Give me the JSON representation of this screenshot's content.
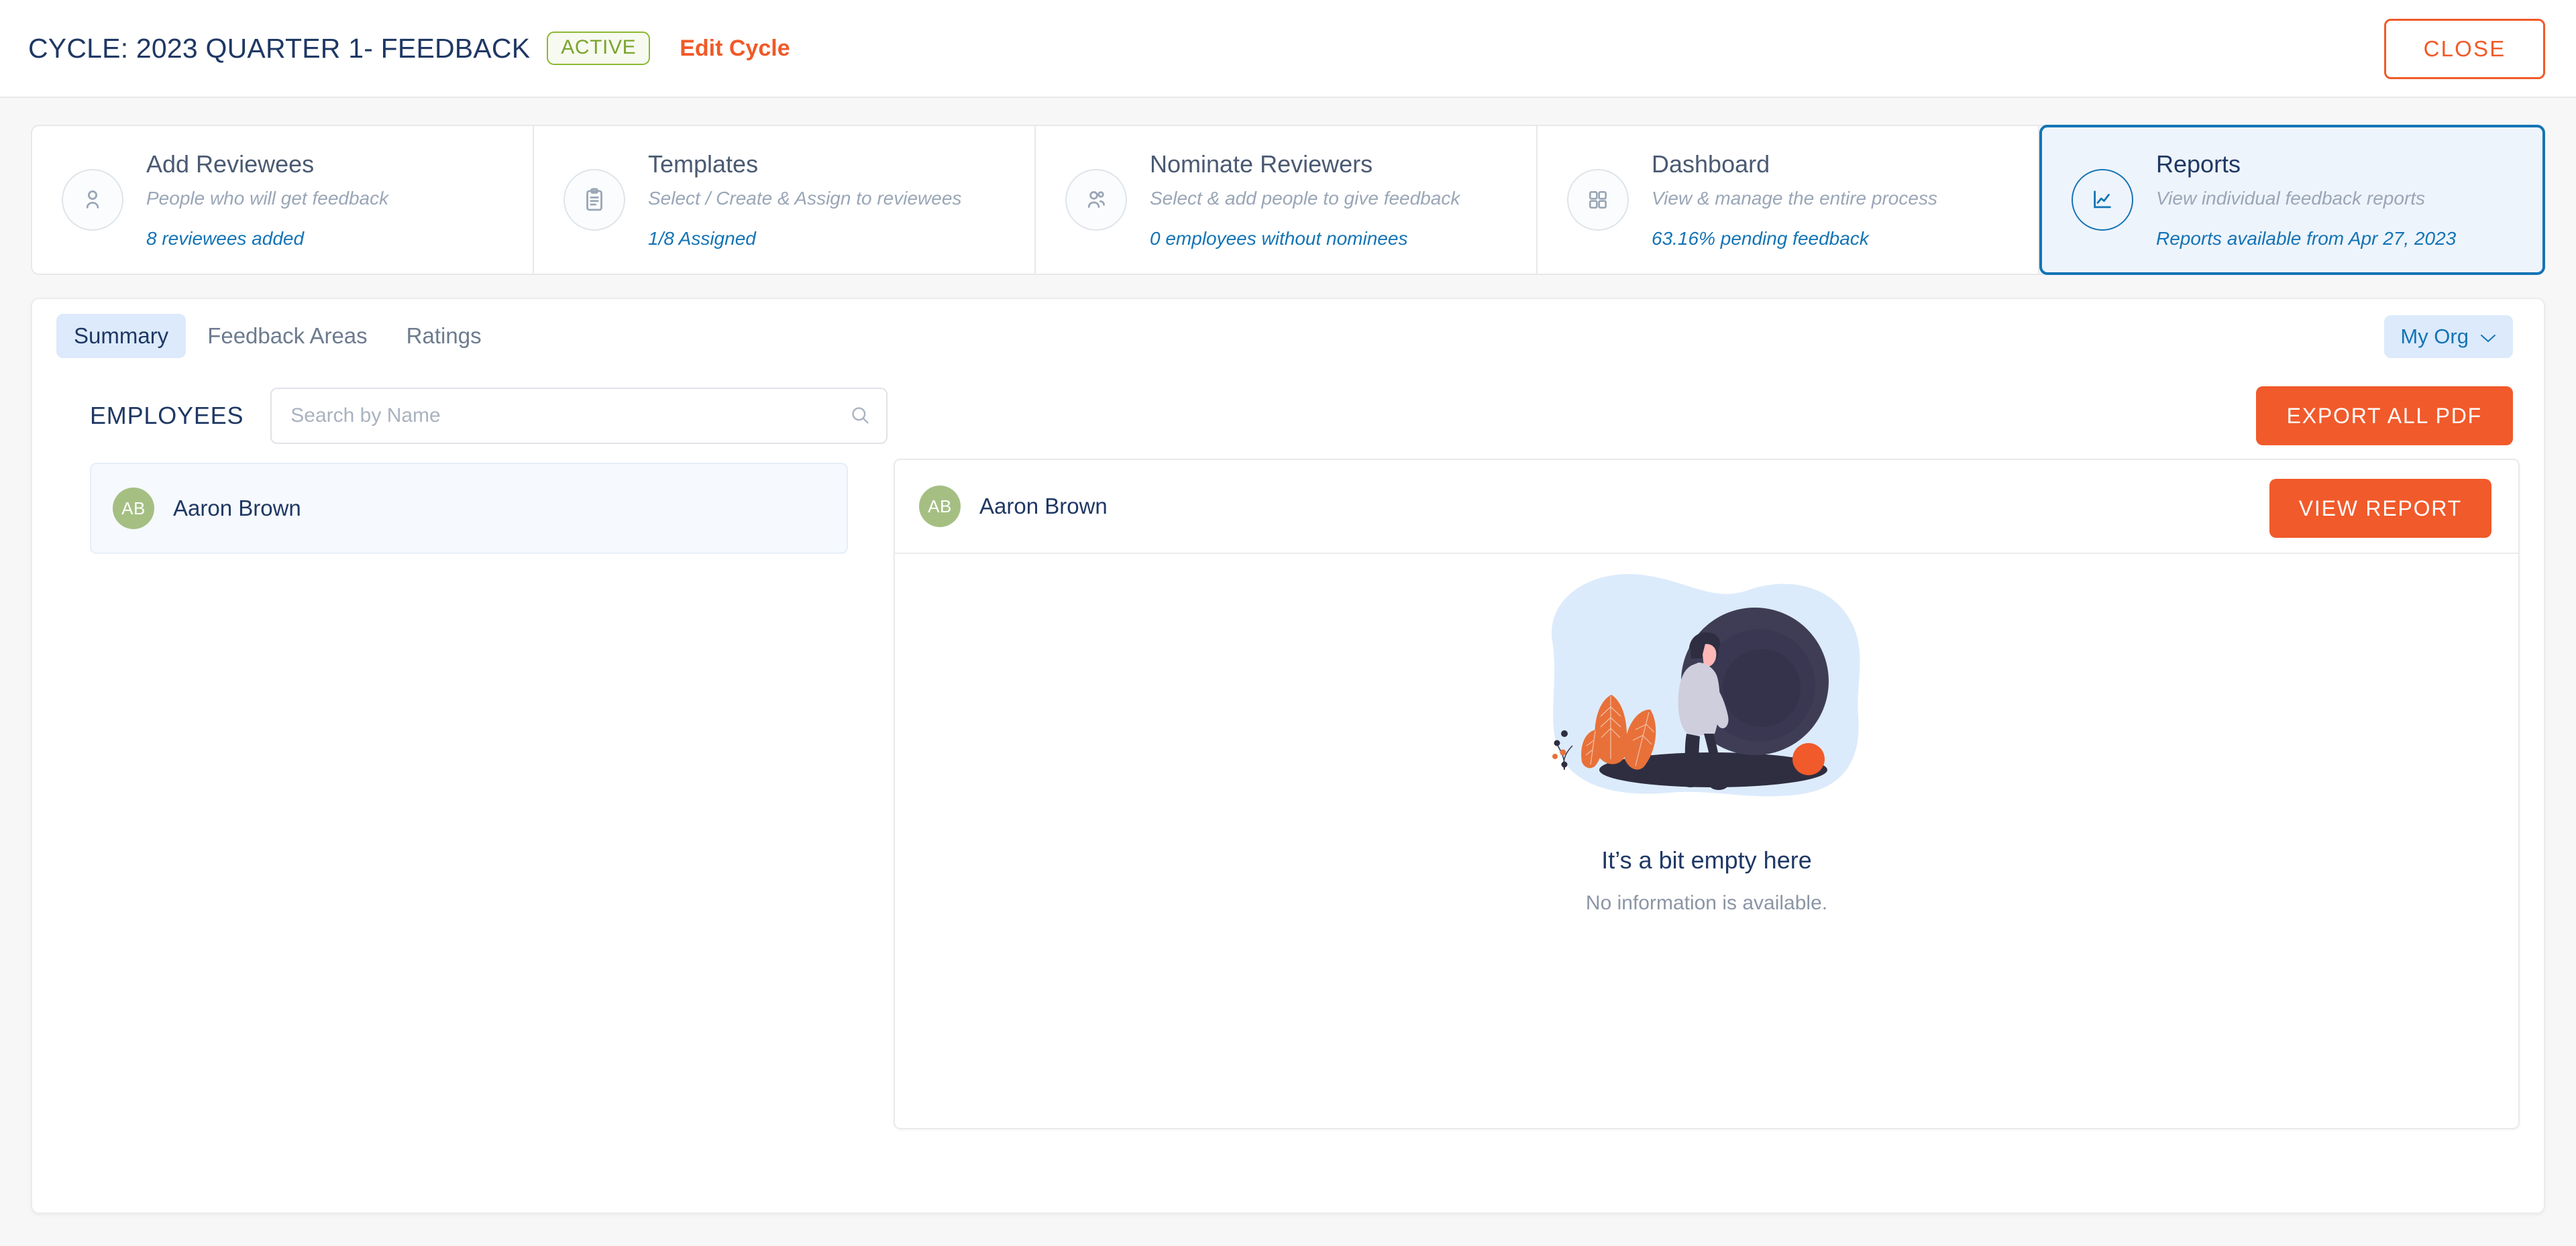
{
  "header": {
    "cycle_title": "CYCLE: 2023 QUARTER 1- FEEDBACK",
    "status_badge": "ACTIVE",
    "edit_link": "Edit Cycle",
    "close_label": "CLOSE"
  },
  "steps": [
    {
      "icon": "user-icon",
      "title": "Add Reviewees",
      "subtitle": "People who will get feedback",
      "stat": "8  reviewees added",
      "active": false
    },
    {
      "icon": "clipboard-icon",
      "title": "Templates",
      "subtitle": "Select / Create & Assign to reviewees",
      "stat": "1/8  Assigned",
      "active": false
    },
    {
      "icon": "users-icon",
      "title": "Nominate Reviewers",
      "subtitle": "Select & add people to give feedback",
      "stat": "0  employees without nominees",
      "active": false
    },
    {
      "icon": "grid-icon",
      "title": "Dashboard",
      "subtitle": "View & manage the entire process",
      "stat": "63.16% pending feedback",
      "active": false
    },
    {
      "icon": "chart-icon",
      "title": "Reports",
      "subtitle": "View individual feedback reports",
      "stat": "Reports available from Apr 27, 2023",
      "active": true
    }
  ],
  "tabs": [
    {
      "label": "Summary",
      "selected": true
    },
    {
      "label": "Feedback Areas",
      "selected": false
    },
    {
      "label": "Ratings",
      "selected": false
    }
  ],
  "org_filter": {
    "label": "My Org",
    "icon": "chevron-down-icon"
  },
  "employees_section": {
    "label": "EMPLOYEES",
    "search_placeholder": "Search by Name",
    "search_value": "",
    "search_icon": "search-icon",
    "export_label": "EXPORT ALL PDF"
  },
  "employee_list": [
    {
      "initials": "AB",
      "name": "Aaron Brown",
      "selected": true
    }
  ],
  "report_panel": {
    "employee": {
      "initials": "AB",
      "name": "Aaron Brown"
    },
    "view_report_label": "VIEW REPORT",
    "empty_state": {
      "illustration": "person-pushing-boulder-illustration",
      "title": "It’s a bit empty here",
      "subtitle": "No information is available."
    }
  },
  "colors": {
    "accent_orange": "#f15a2b",
    "accent_blue": "#1474b4",
    "navy_text": "#1f3864",
    "badge_green": "#7aa32c",
    "avatar_green": "#a5bf83",
    "page_bg": "#f7f7f7"
  }
}
